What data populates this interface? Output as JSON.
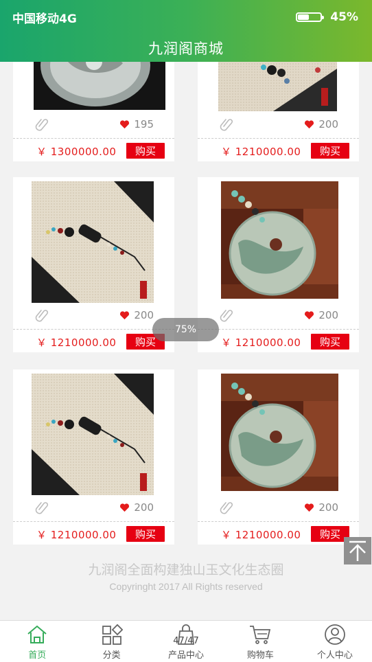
{
  "status_bar": {
    "carrier": "中国移动4G",
    "battery": "45%",
    "battery_level": 0.45
  },
  "app_title": "九润阁商城",
  "products": [
    {
      "likes": "195",
      "price": "￥ 1300000.00",
      "buy_label": "购买",
      "image": "jade-pendant-dark"
    },
    {
      "likes": "200",
      "price": "￥ 1210000.00",
      "buy_label": "购买",
      "image": "jade-necklace-beads"
    },
    {
      "likes": "200",
      "price": "￥ 1210000.00",
      "buy_label": "购买",
      "image": "jade-necklace-beads"
    },
    {
      "likes": "200",
      "price": "￥ 1210000.00",
      "buy_label": "购买",
      "image": "jade-disc-wood"
    },
    {
      "likes": "200",
      "price": "￥ 1210000.00",
      "buy_label": "购买",
      "image": "jade-necklace-beads"
    },
    {
      "likes": "200",
      "price": "￥ 1210000.00",
      "buy_label": "购买",
      "image": "jade-disc-wood"
    }
  ],
  "toast": "75%",
  "footer": {
    "slogan": "九润阁全面构建独山玉文化生态圈",
    "copyright": "Copyringht 2017 All Rights reserved"
  },
  "tabs": [
    {
      "label": "首页",
      "icon": "home-icon",
      "active": true
    },
    {
      "label": "分类",
      "icon": "category-icon",
      "active": false
    },
    {
      "label": "产品中心",
      "icon": "bag-icon",
      "active": false,
      "page_indicator": "47/47"
    },
    {
      "label": "购物车",
      "icon": "cart-icon",
      "active": false
    },
    {
      "label": "个人中心",
      "icon": "user-icon",
      "active": false
    }
  ],
  "colors": {
    "accent": "#35ac5a",
    "price": "#e41c1c",
    "buy": "#e60012"
  }
}
